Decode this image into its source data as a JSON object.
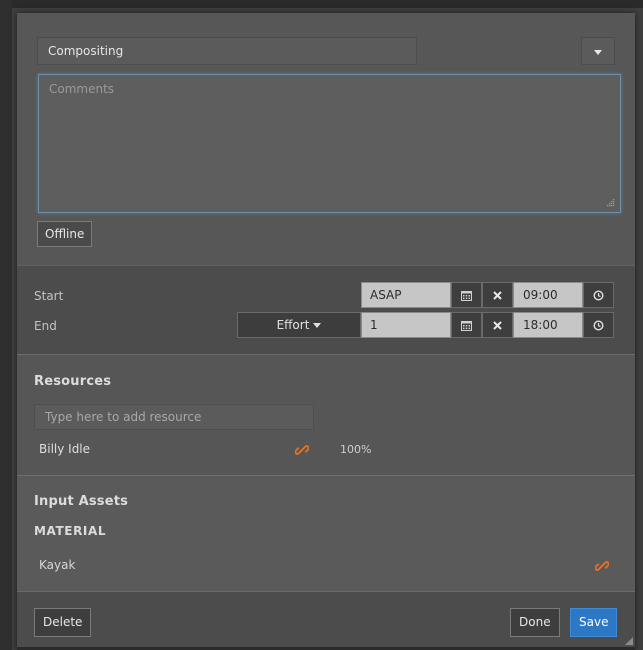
{
  "task_form": {
    "task_type": "Compositing",
    "comments_placeholder": "Comments",
    "offline_label": "Offline"
  },
  "schedule": {
    "start_label": "Start",
    "start_date": "ASAP",
    "start_time": "09:00",
    "end_label": "End",
    "end_mode_label": "Effort",
    "end_value": "1",
    "end_time": "18:00"
  },
  "resources": {
    "title": "Resources",
    "input_placeholder": "Type here to add resource",
    "items": [
      {
        "name": "Billy Idle",
        "allocation": "100%"
      }
    ]
  },
  "input_assets": {
    "title": "Input Assets",
    "category": "MATERIAL",
    "items": [
      {
        "name": "Kayak"
      }
    ]
  },
  "footer": {
    "delete_label": "Delete",
    "done_label": "Done",
    "save_label": "Save"
  },
  "colors": {
    "accent_save": "#2d78c4",
    "link_icon": "#e0742a",
    "focus_border": "#6e8fa8"
  },
  "icons": {
    "calendar": "calendar-icon",
    "clear": "close-icon",
    "clock": "clock-icon",
    "link": "link-icon",
    "dropdown": "chevron-down-icon"
  }
}
